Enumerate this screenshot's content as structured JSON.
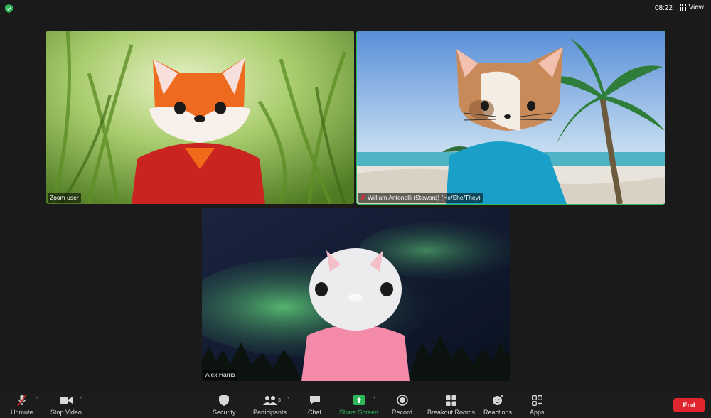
{
  "topbar": {
    "time": "08:22",
    "view_label": "View"
  },
  "participants": [
    {
      "name": "Zoom user"
    },
    {
      "name": "William Antonelli (Steward) (He/She/They)",
      "muted": true,
      "active_speaker": true
    },
    {
      "name": "Alex Harris"
    }
  ],
  "toolbar": {
    "unmute": "Unmute",
    "stop_video": "Stop Video",
    "security": "Security",
    "participants": "Participants",
    "participants_count": "3",
    "chat": "Chat",
    "share_screen": "Share Screen",
    "record": "Record",
    "breakout_rooms": "Breakout Rooms",
    "reactions": "Reactions",
    "apps": "Apps",
    "end": "End"
  },
  "colors": {
    "accent_green": "#2fb75b",
    "end_red": "#e0252f"
  }
}
